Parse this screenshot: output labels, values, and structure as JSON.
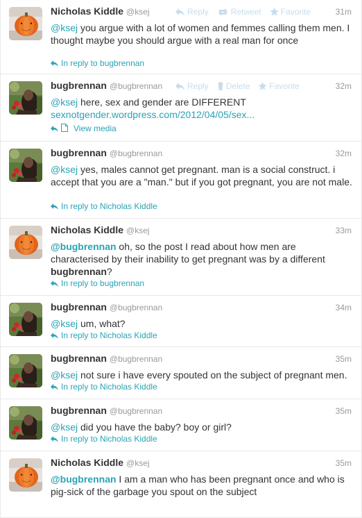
{
  "actions": {
    "reply": "Reply",
    "retweet": "Retweet",
    "favorite": "Favorite",
    "delete": "Delete"
  },
  "tweets": [
    {
      "fullname": "Nicholas Kiddle",
      "username": "@ksej",
      "time": "31m",
      "parts": [
        {
          "t": "@ksej",
          "c": "mention"
        },
        {
          "t": " you argue with a lot of women and femmes calling them men. I thought maybe you should argue with a real man for once"
        }
      ],
      "context": "In reply to bugbrennan",
      "avatar": "pumpkin"
    },
    {
      "fullname": "bugbrennan",
      "username": "@bugbrennan",
      "time": "32m",
      "parts": [
        {
          "t": "@ksej",
          "c": "mention"
        },
        {
          "t": " here, sex and gender are DIFFERENT "
        },
        {
          "t": "sexnotgender.wordpress.com/2012/04/05/sex...",
          "c": "link"
        }
      ],
      "context": "View media",
      "avatar": "photo"
    },
    {
      "fullname": "bugbrennan",
      "username": "@bugbrennan",
      "time": "32m",
      "parts": [
        {
          "t": "@ksej",
          "c": "mention"
        },
        {
          "t": " yes, males cannot get pregnant. man is a social construct. i accept that you are a \"man.\" but if you got pregnant, you are not male."
        }
      ],
      "context": "In reply to Nicholas Kiddle",
      "avatar": "photo"
    },
    {
      "fullname": "Nicholas Kiddle",
      "username": "@ksej",
      "time": "33m",
      "parts": [
        {
          "t": "@bugbrennan",
          "c": "mention-b"
        },
        {
          "t": " oh, so the post I read about how men are characterised by their inability to get pregnant was by a different "
        },
        {
          "t": "bugbrennan",
          "c": "bold"
        },
        {
          "t": "?"
        }
      ],
      "context": "In reply to bugbrennan",
      "avatar": "pumpkin"
    },
    {
      "fullname": "bugbrennan",
      "username": "@bugbrennan",
      "time": "34m",
      "parts": [
        {
          "t": "@ksej",
          "c": "mention"
        },
        {
          "t": " um, what?"
        }
      ],
      "context": "In reply to Nicholas Kiddle",
      "avatar": "photo"
    },
    {
      "fullname": "bugbrennan",
      "username": "@bugbrennan",
      "time": "35m",
      "parts": [
        {
          "t": "@ksej",
          "c": "mention"
        },
        {
          "t": " not sure i have every spouted on the subject of pregnant men."
        }
      ],
      "context": "In reply to Nicholas Kiddle",
      "avatar": "photo"
    },
    {
      "fullname": "bugbrennan",
      "username": "@bugbrennan",
      "time": "35m",
      "parts": [
        {
          "t": "@ksej",
          "c": "mention"
        },
        {
          "t": " did you have the baby? boy or girl?"
        }
      ],
      "context": "In reply to Nicholas Kiddle",
      "avatar": "photo"
    },
    {
      "fullname": "Nicholas Kiddle",
      "username": "@ksej",
      "time": "35m",
      "parts": [
        {
          "t": "@bugbrennan",
          "c": "mention-b"
        },
        {
          "t": " I am a man who has been pregnant once and who is pig-sick of the garbage you spout on the subject"
        }
      ],
      "context": "",
      "avatar": "pumpkin"
    }
  ]
}
